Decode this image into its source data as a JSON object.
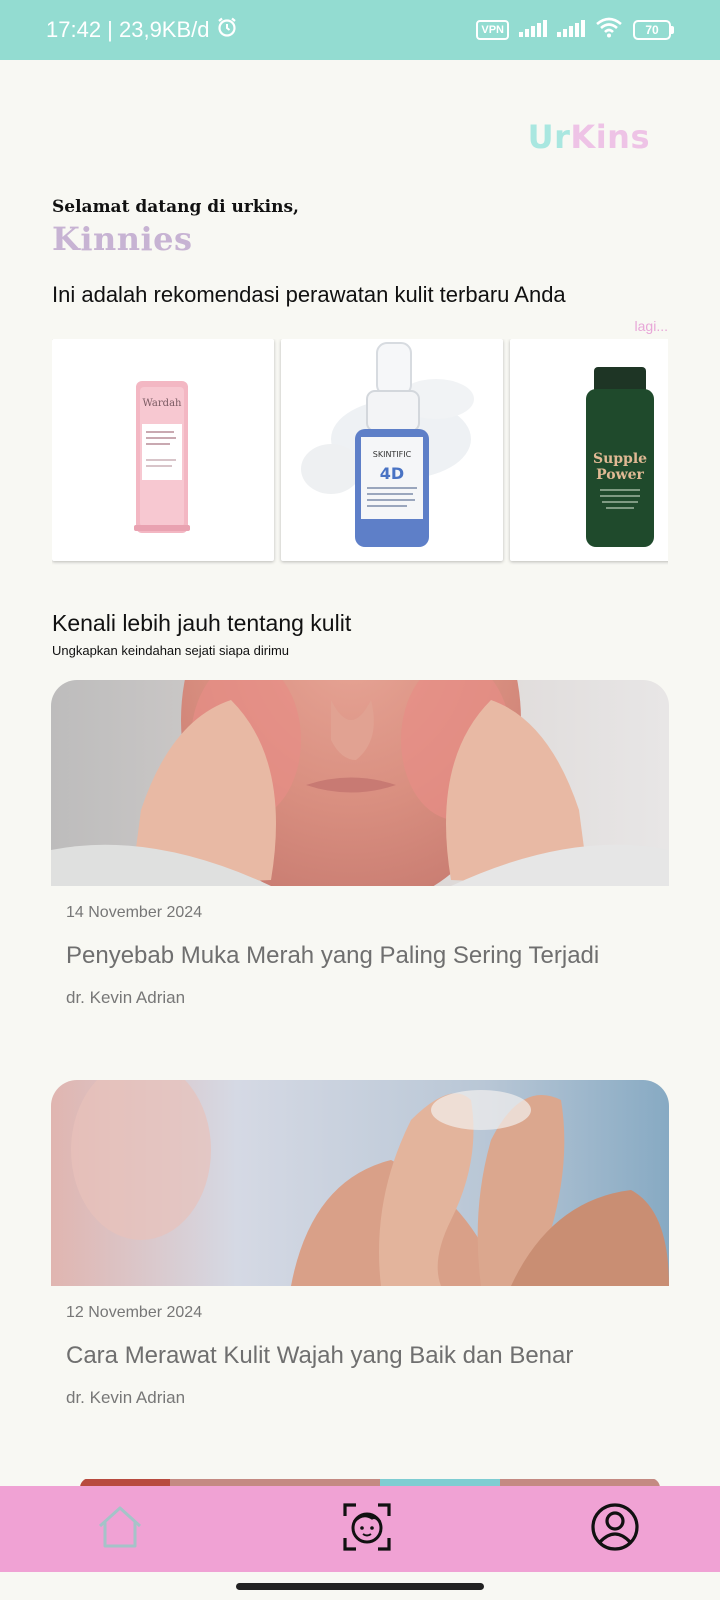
{
  "status_bar": {
    "time_speed": "17:42 | 23,9KB/d",
    "vpn": "VPN",
    "battery": "70"
  },
  "brand": {
    "part1": "Ur",
    "part2": "Kins"
  },
  "greeting": {
    "welcome": "Selamat datang di urkins,",
    "username": "Kinnies"
  },
  "recommendations": {
    "title": "Ini adalah rekomendasi perawatan kulit terbaru Anda",
    "more_label": "lagi...",
    "products": [
      {
        "brand_text": "Wardah",
        "label_text": ""
      },
      {
        "brand_text": "SKINTIFIC",
        "label_text": "4D"
      },
      {
        "brand_text": "Supple",
        "label_text": "Power"
      }
    ]
  },
  "section": {
    "title": "Kenali lebih jauh tentang kulit",
    "subtitle": "Ungkapkan keindahan sejati siapa dirimu"
  },
  "articles": [
    {
      "date": "14 November 2024",
      "title": "Penyebab Muka Merah yang Paling Sering Terjadi",
      "author": "dr. Kevin Adrian"
    },
    {
      "date": "12 November 2024",
      "title": "Cara Merawat Kulit Wajah yang Baik dan Benar",
      "author": "dr. Kevin Adrian"
    }
  ],
  "nav": {
    "items": [
      {
        "icon": "home-icon"
      },
      {
        "icon": "face-scan-icon"
      },
      {
        "icon": "profile-icon"
      }
    ]
  },
  "colors": {
    "status_bar": "#93dcd1",
    "nav_bar": "#f0a2d4",
    "accent_pink": "#e8a7d8",
    "accent_teal": "#a9e7e0",
    "username": "#c7b3d3"
  }
}
